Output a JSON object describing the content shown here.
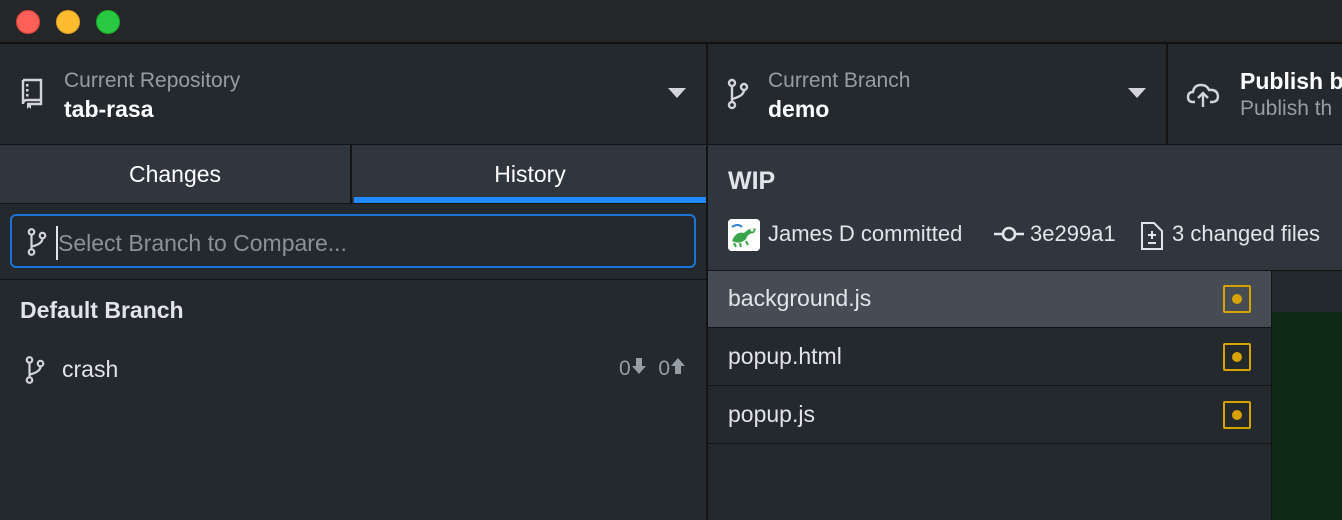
{
  "toolbar": {
    "repository": {
      "label": "Current Repository",
      "value": "tab-rasa"
    },
    "branch": {
      "label": "Current Branch",
      "value": "demo"
    },
    "publish": {
      "title": "Publish b",
      "subtitle": "Publish th"
    }
  },
  "tabs": [
    {
      "label": "Changes",
      "active": false
    },
    {
      "label": "History",
      "active": true
    }
  ],
  "compare": {
    "placeholder": "Select Branch to Compare..."
  },
  "branches": {
    "section": "Default Branch",
    "items": [
      {
        "name": "crash",
        "behind": "0",
        "ahead": "0"
      }
    ]
  },
  "commit": {
    "title": "WIP",
    "author": "James D committed",
    "sha": "3e299a1",
    "files_changed": "3 changed files",
    "files": [
      {
        "name": "background.js",
        "status": "modified",
        "selected": true
      },
      {
        "name": "popup.html",
        "status": "modified",
        "selected": false
      },
      {
        "name": "popup.js",
        "status": "modified",
        "selected": false
      }
    ]
  },
  "colors": {
    "accent": "#2188ff",
    "modified": "#d6a300",
    "window_close": "#fe5f57",
    "window_minimize": "#febc2e",
    "window_zoom": "#28c840"
  }
}
